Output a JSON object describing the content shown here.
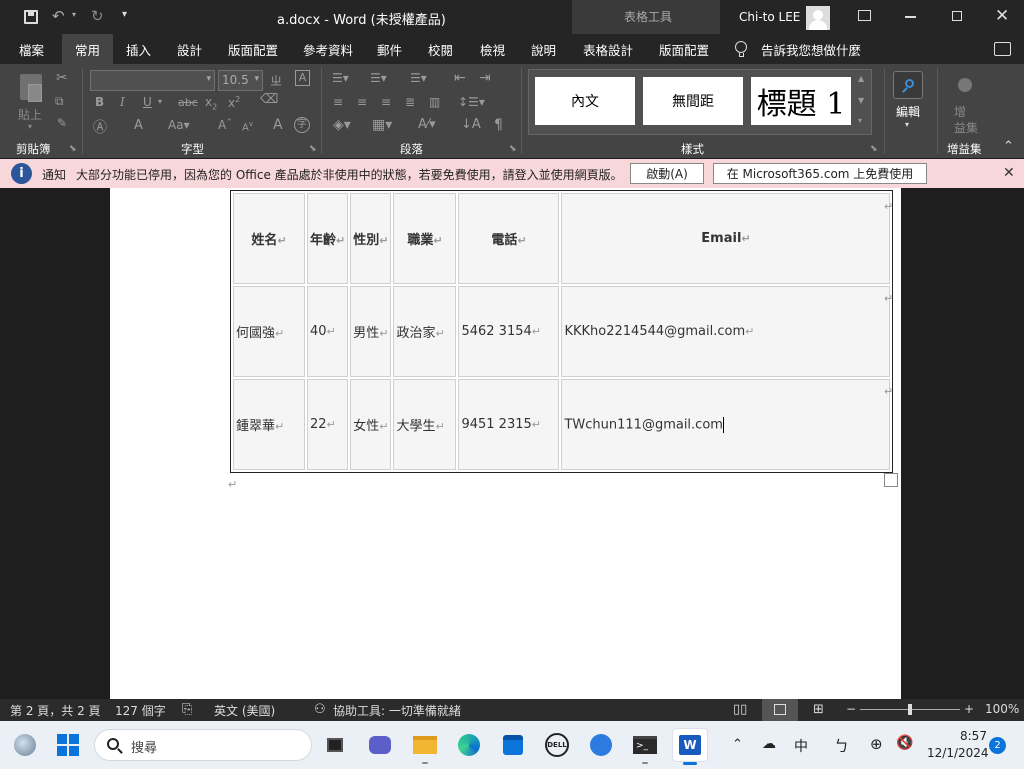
{
  "titlebar": {
    "title": "a.docx - Word (未授權產品)",
    "table_tools": "表格工具",
    "user": "Chi-to LEE"
  },
  "tabs": {
    "file": "檔案",
    "home": "常用",
    "insert": "插入",
    "design": "設計",
    "layout": "版面配置",
    "references": "參考資料",
    "mailings": "郵件",
    "review": "校閱",
    "view": "檢視",
    "help": "說明",
    "table_design": "表格設計",
    "table_layout": "版面配置",
    "tell_me": "告訴我您想做什麼"
  },
  "ribbon": {
    "paste": "貼上",
    "font_size": "10.5",
    "groups": {
      "clipboard": "剪貼簿",
      "font": "字型",
      "paragraph": "段落",
      "styles": "樣式",
      "editing": "編輯",
      "addins": "增益集"
    },
    "styles": {
      "normal": "內文",
      "no_spacing": "無間距",
      "heading1": "標題 1"
    },
    "addin_label": "增\n益集"
  },
  "notification": {
    "label": "通知",
    "message": "大部分功能已停用，因為您的 Office 產品處於非使用中的狀態，若要免費使用，請登入並使用網頁版。",
    "activate": "啟動(A)",
    "free_web": "在 Microsoft365.com 上免費使用"
  },
  "document": {
    "headers": [
      "姓名",
      "年齡",
      "性別",
      "職業",
      "電話",
      "Email"
    ],
    "rows": [
      [
        "何國強",
        "40",
        "男性",
        "政治家",
        "5462 3154",
        "KKKho2214544@gmail.com"
      ],
      [
        "鍾翠華",
        "22",
        "女性",
        "大學生",
        "9451 2315",
        "TWchun111@gmail.com"
      ]
    ]
  },
  "statusbar": {
    "page": "第 2 頁，共 2 頁",
    "words": "127 個字",
    "language": "英文 (美國)",
    "accessibility": "協助工具: 一切準備就緒",
    "zoom": "100%"
  },
  "taskbar": {
    "search": "搜尋",
    "ime": "中",
    "time": "8:57",
    "date": "12/1/2024",
    "badge": "2"
  }
}
